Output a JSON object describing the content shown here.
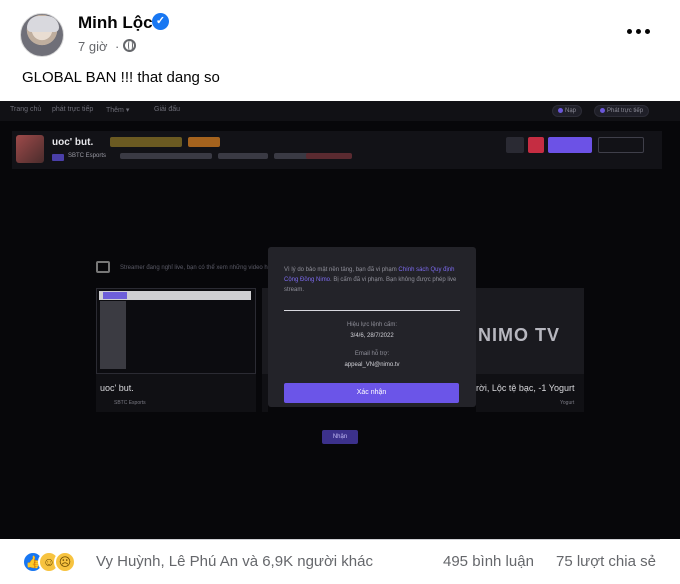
{
  "post": {
    "author": "Minh Lộc",
    "time": "7 giờ",
    "separator": "·",
    "text": "GLOBAL BAN !!! that dang so"
  },
  "nimo": {
    "nav": [
      "Trang chủ",
      "phát trực tiếp",
      "Thêm ▾",
      "Giải đấu"
    ],
    "nav_right": [
      "Nạp",
      "Phát trực tiếp"
    ],
    "streamer_name": "uoc' but.",
    "team": "SBTC Esports",
    "background_text": "Streamer đang nghỉ live, bạn có thể xem những video hay",
    "cards": [
      {
        "title": "uoc' but.",
        "sub": "SBTC Esports"
      },
      {
        "title": "",
        "sub": ""
      },
      {
        "title": "rời, Lộc tệ bạc, -1 Yogurt",
        "sub": "Yogurt"
      }
    ],
    "logo": "NIMO TV",
    "modal": {
      "message_a": "Vì lý do bảo mật nền tảng, bạn đã vi phạm ",
      "message_link": "Chính sách Quy định Cộng Đồng Nimo",
      "message_b": ". Bị cấm đã vi phạm. Bạn không được phép live stream.",
      "ban_label": "Hiệu lực lệnh cấm:",
      "ban_value": "3/4/6, 28/7/2022",
      "email_label": "Email hỗ trợ:",
      "email_value": "appeal_VN@nimo.tv",
      "confirm": "Xác nhận"
    },
    "small_button": "Nhận"
  },
  "footer": {
    "reactions": "Vy Huỳnh, Lê Phú An và 6,9K người khác",
    "comments": "495 bình luận",
    "shares": "75 lượt chia sẻ"
  },
  "colors": {
    "verified": "#1877f2",
    "nimo_purple": "#6b55e8"
  },
  "icons": [
    "verified-icon",
    "globe-icon",
    "more-icon",
    "like-icon",
    "haha-icon",
    "sad-icon"
  ]
}
